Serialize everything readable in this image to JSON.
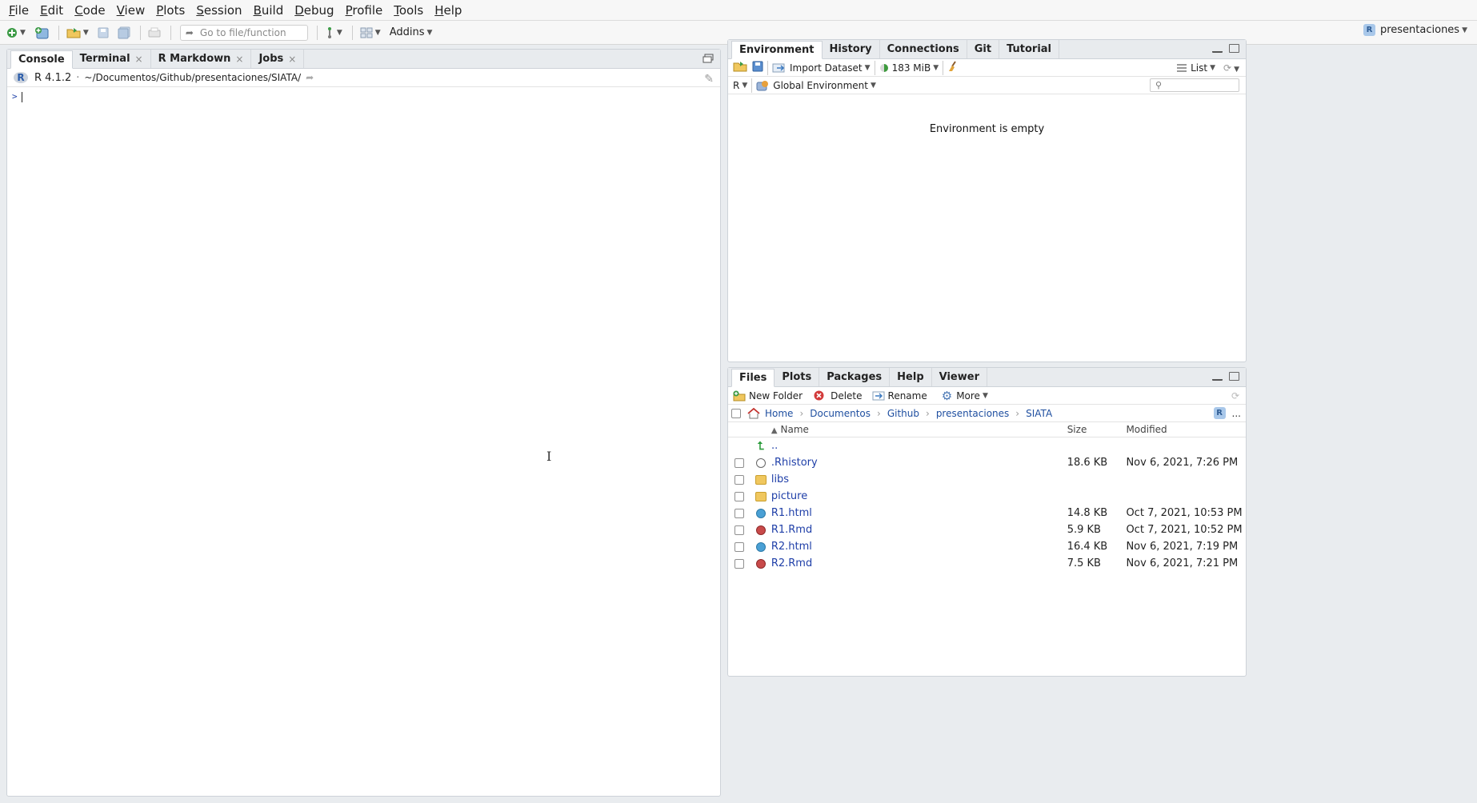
{
  "menubar": {
    "items": [
      "File",
      "Edit",
      "Code",
      "View",
      "Plots",
      "Session",
      "Build",
      "Debug",
      "Profile",
      "Tools",
      "Help"
    ]
  },
  "toolbar": {
    "goto_placeholder": "Go to file/function",
    "addins_label": "Addins",
    "project_name": "presentaciones"
  },
  "console_pane": {
    "tabs": [
      {
        "label": "Console",
        "closable": false,
        "active": true
      },
      {
        "label": "Terminal",
        "closable": true,
        "active": false
      },
      {
        "label": "R Markdown",
        "closable": true,
        "active": false
      },
      {
        "label": "Jobs",
        "closable": true,
        "active": false
      }
    ],
    "r_version": "R 4.1.2",
    "separator": "·",
    "working_dir": "~/Documentos/Github/presentaciones/SIATA/",
    "prompt": ">"
  },
  "env_pane": {
    "tabs": [
      {
        "label": "Environment",
        "active": true
      },
      {
        "label": "History",
        "active": false
      },
      {
        "label": "Connections",
        "active": false
      },
      {
        "label": "Git",
        "active": false
      },
      {
        "label": "Tutorial",
        "active": false
      }
    ],
    "import_dataset_label": "Import Dataset",
    "memory_label": "183 MiB",
    "view_mode_label": "List",
    "language_label": "R",
    "scope_label": "Global Environment",
    "empty_message": "Environment is empty"
  },
  "files_pane": {
    "tabs": [
      {
        "label": "Files",
        "active": true
      },
      {
        "label": "Plots",
        "active": false
      },
      {
        "label": "Packages",
        "active": false
      },
      {
        "label": "Help",
        "active": false
      },
      {
        "label": "Viewer",
        "active": false
      }
    ],
    "new_folder_label": "New Folder",
    "delete_label": "Delete",
    "rename_label": "Rename",
    "more_label": "More",
    "breadcrumb": [
      "Home",
      "Documentos",
      "Github",
      "presentaciones",
      "SIATA"
    ],
    "more_path": "...",
    "columns": {
      "name": "Name",
      "size": "Size",
      "modified": "Modified"
    },
    "sort_indicator": "▲",
    "up_label": "..",
    "files": [
      {
        "name": ".Rhistory",
        "size": "18.6 KB",
        "modified": "Nov 6, 2021, 7:26 PM",
        "icon": "history-file-icon"
      },
      {
        "name": "libs",
        "size": "",
        "modified": "",
        "icon": "folder-icon"
      },
      {
        "name": "picture",
        "size": "",
        "modified": "",
        "icon": "folder-icon"
      },
      {
        "name": "R1.html",
        "size": "14.8 KB",
        "modified": "Oct 7, 2021, 10:53 PM",
        "icon": "html-file-icon"
      },
      {
        "name": "R1.Rmd",
        "size": "5.9 KB",
        "modified": "Oct 7, 2021, 10:52 PM",
        "icon": "rmd-file-icon"
      },
      {
        "name": "R2.html",
        "size": "16.4 KB",
        "modified": "Nov 6, 2021, 7:19 PM",
        "icon": "html-file-icon"
      },
      {
        "name": "R2.Rmd",
        "size": "7.5 KB",
        "modified": "Nov 6, 2021, 7:21 PM",
        "icon": "rmd-file-icon"
      }
    ]
  }
}
